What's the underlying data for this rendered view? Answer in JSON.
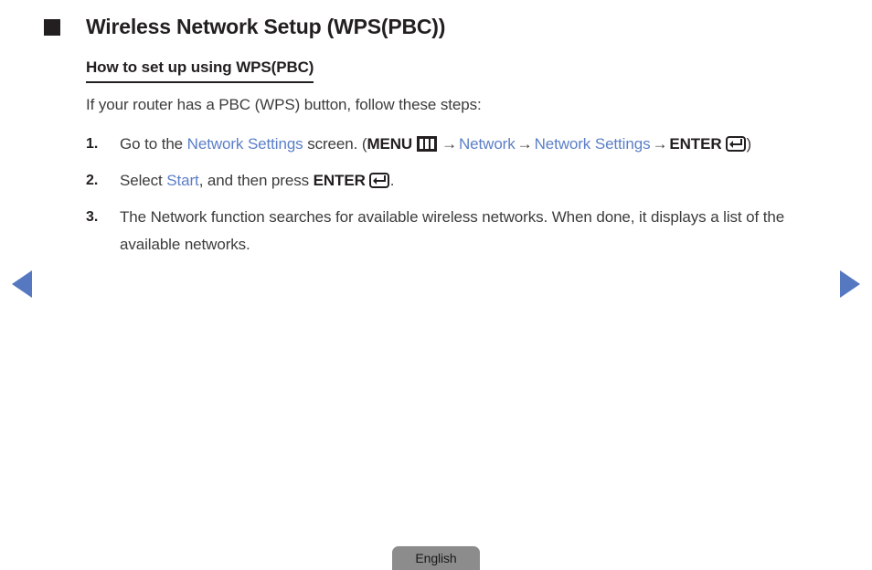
{
  "page": {
    "title": "Wireless Network Setup (WPS(PBC))",
    "bullet_icon": "filled-square-bullet",
    "subtitle": "How to set up using WPS(PBC)",
    "intro": "If your router has a PBC (WPS) button, follow these steps:"
  },
  "colors": {
    "link_blue": "#5b7fc7",
    "nav_arrow_blue": "#5578c0",
    "text": "#3c3c3c",
    "heading": "#231f20",
    "badge_bg": "#8c8c8c"
  },
  "steps": [
    {
      "number": "1.",
      "parts": [
        {
          "type": "text",
          "value": "Go to the "
        },
        {
          "type": "link",
          "value": "Network Settings"
        },
        {
          "type": "text",
          "value": " screen. ("
        },
        {
          "type": "keyword",
          "value": "MENU"
        },
        {
          "type": "icon",
          "value": "menu-icon"
        },
        {
          "type": "arrow",
          "value": "→"
        },
        {
          "type": "link",
          "value": "Network"
        },
        {
          "type": "arrow",
          "value": "→"
        },
        {
          "type": "link",
          "value": "Network Settings"
        },
        {
          "type": "arrow",
          "value": "→"
        },
        {
          "type": "keyword",
          "value": "ENTER"
        },
        {
          "type": "icon",
          "value": "enter-icon"
        },
        {
          "type": "text",
          "value": ")"
        }
      ]
    },
    {
      "number": "2.",
      "parts": [
        {
          "type": "text",
          "value": "Select "
        },
        {
          "type": "link",
          "value": "Start"
        },
        {
          "type": "text",
          "value": ", and then press "
        },
        {
          "type": "keyword",
          "value": "ENTER"
        },
        {
          "type": "icon",
          "value": "enter-icon"
        },
        {
          "type": "text",
          "value": "."
        }
      ]
    },
    {
      "number": "3.",
      "parts": [
        {
          "type": "text",
          "value": "The Network function searches for available wireless networks. When done, it displays a list of the available networks."
        }
      ]
    }
  ],
  "nav": {
    "prev_label": "previous-page",
    "next_label": "next-page"
  },
  "footer": {
    "language": "English"
  },
  "step1_line1": {
    "pre": "Go to the ",
    "link1": "Network Settings",
    "mid": " screen. (",
    "menu": "MENU",
    "arrow": "→",
    "link2": "Network",
    "link3a": "Network"
  },
  "step1_line2": {
    "link3b": "Settings",
    "arrow": "→",
    "enter": "ENTER",
    "close": ")"
  },
  "step2_text": {
    "pre": "Select ",
    "link": "Start",
    "mid": ", and then press ",
    "enter": "ENTER",
    "post": "."
  },
  "step3_text": {
    "body": "The Network function searches for available wireless networks. When done, it displays a list of the available networks."
  }
}
